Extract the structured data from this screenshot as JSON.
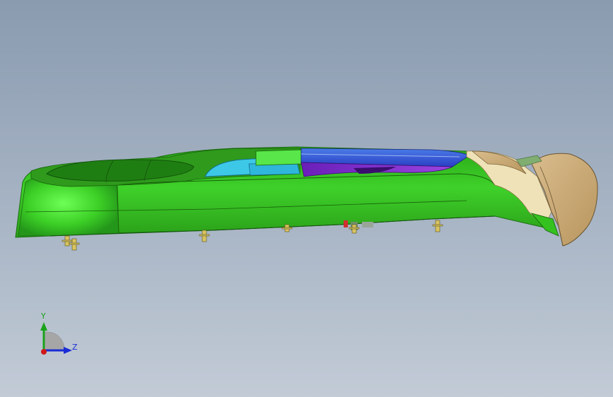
{
  "viewport": {
    "background_top": "#8a9bb0",
    "background_bottom": "#c2cbd6"
  },
  "model": {
    "part_colors": {
      "body": "#35c11f",
      "body_highlight": "#5ef04a",
      "body_dark": "#1f8a12",
      "glass_cyan": "#3ec8e8",
      "trim_blue": "#2e52d8",
      "trim_purple": "#7a28c8",
      "end_cap_tan": "#c8ab7c",
      "end_cap_cream": "#efe2b8",
      "fastener_gold": "#d8c460"
    }
  },
  "triad": {
    "y_label": "Y",
    "z_label": "Z",
    "y_color": "#1aa31a",
    "z_color": "#1a2cd6",
    "origin_color": "#d01818"
  }
}
